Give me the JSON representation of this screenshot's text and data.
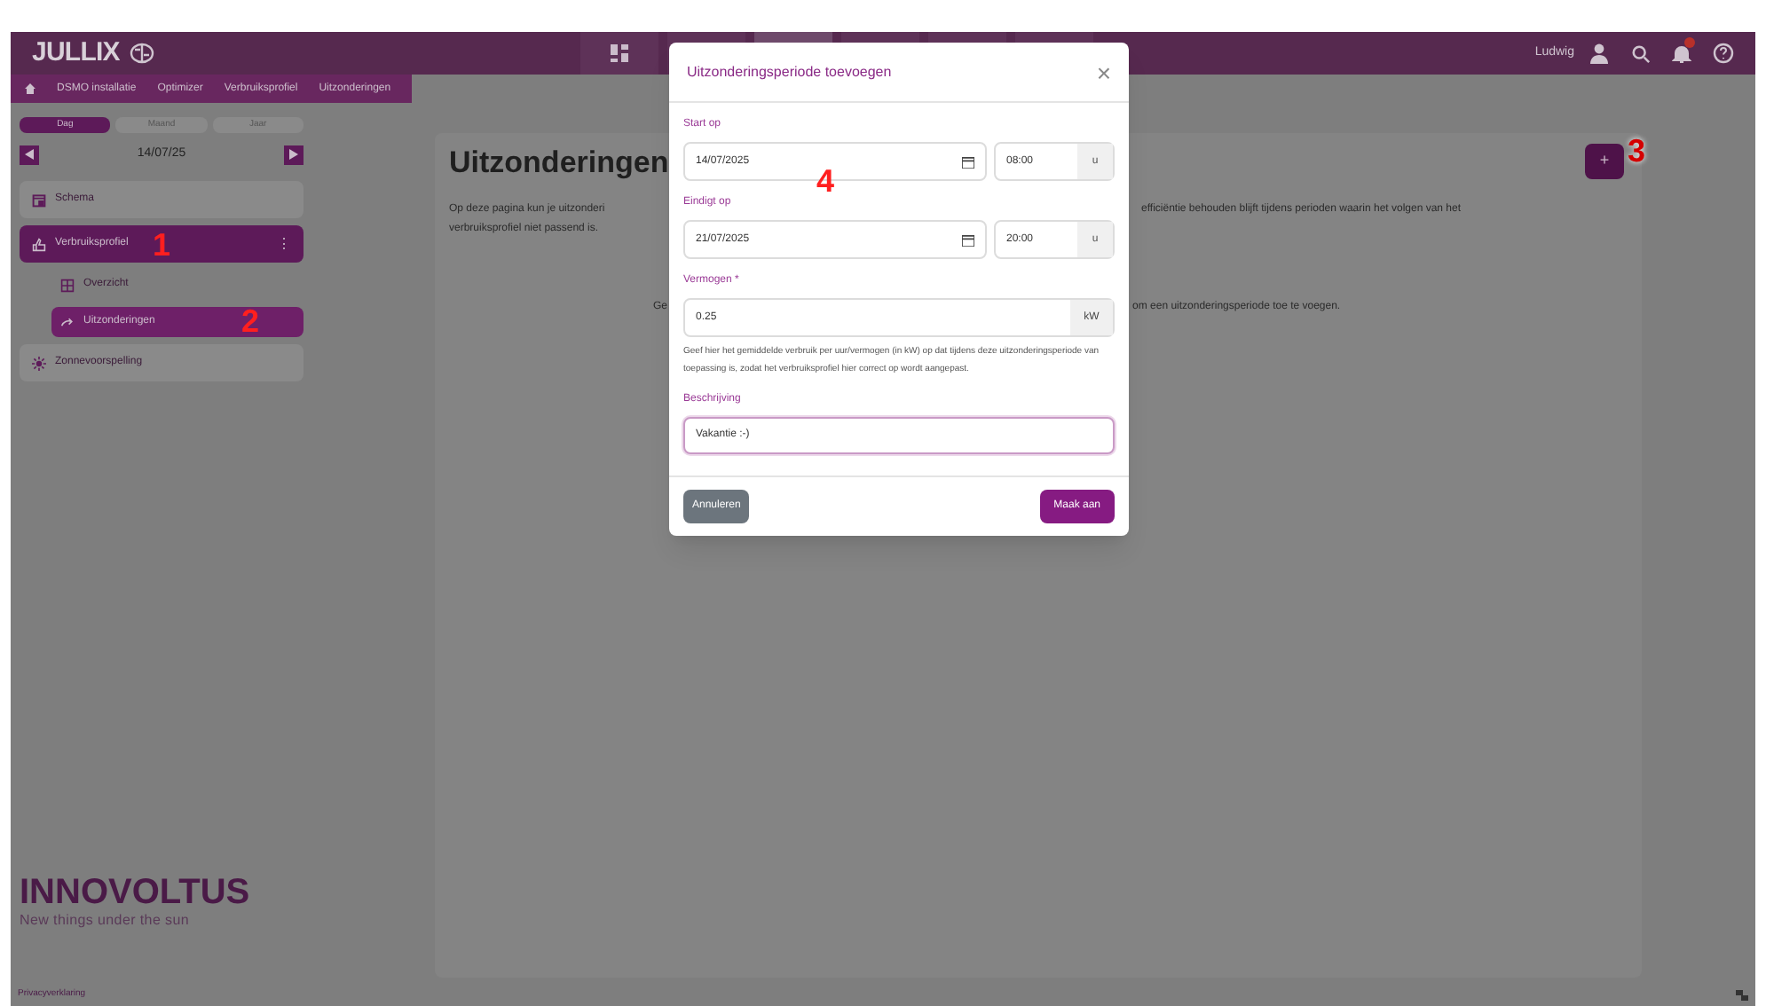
{
  "header": {
    "logo": "JULLIX",
    "nav": [
      {
        "selected": false
      },
      {
        "selected": false
      },
      {
        "selected": true
      },
      {
        "selected": false
      },
      {
        "selected": false
      },
      {
        "selected": false
      }
    ],
    "user": "Ludwig",
    "notification_badge": true
  },
  "breadcrumb": [
    "DSMO installatie",
    "Optimizer",
    "Verbruiksprofiel",
    "Uitzonderingen"
  ],
  "sidebar": {
    "periods": [
      {
        "label": "Dag",
        "selected": true
      },
      {
        "label": "Maand",
        "selected": false
      },
      {
        "label": "Jaar",
        "selected": false
      }
    ],
    "date": "14/07/25",
    "items": [
      {
        "label": "Schema",
        "selected": false,
        "kind": "calendar"
      },
      {
        "label": "Verbruiksprofiel",
        "selected": true,
        "kind": "hand",
        "menu": "⋮",
        "children": [
          {
            "label": "Overzicht",
            "selected": false,
            "kind": "grid"
          },
          {
            "label": "Uitzonderingen",
            "selected": true,
            "kind": "arrow"
          }
        ]
      },
      {
        "label": "Zonnevoorspelling",
        "selected": false,
        "kind": "sun"
      }
    ],
    "brand": "INNOVOLTUS",
    "tagline": "New things under the sun"
  },
  "main": {
    "title": "Uitzonderingen",
    "intro_left": "Op deze pagina kun je uitzonderi",
    "intro_right": "efficiëntie behouden blijft tijdens perioden waarin het volgen van het",
    "intro_line2": "verbruiksprofiel niet passend is.",
    "empty_left": "Ge",
    "empty_right": "om een uitzonderingsperiode toe te voegen.",
    "add_button": "+"
  },
  "dialog": {
    "title": "Uitzonderingsperiode toevoegen",
    "close": "×",
    "start": {
      "label": "Start op",
      "date": "14/07/2025",
      "time": "08:00",
      "unit": "u"
    },
    "end": {
      "label": "Eindigt op",
      "date": "21/07/2025",
      "time": "20:00",
      "unit": "u"
    },
    "power": {
      "label": "Vermogen *",
      "value": "0.25",
      "unit": "kW",
      "help": "Geef hier het gemiddelde verbruik per uur/vermogen (in kW) op dat tijdens deze uitzonderingsperiode van toepassing is, zodat het verbruiksprofiel hier correct op wordt aangepast."
    },
    "description": {
      "label": "Beschrijving",
      "value": "Vakantie :-)",
      "focused": true
    },
    "cancel": "Annuleren",
    "submit": "Maak aan"
  },
  "annotations": [
    "1",
    "2",
    "3",
    "4"
  ],
  "footer": {
    "link": "Privacyverklaring"
  }
}
